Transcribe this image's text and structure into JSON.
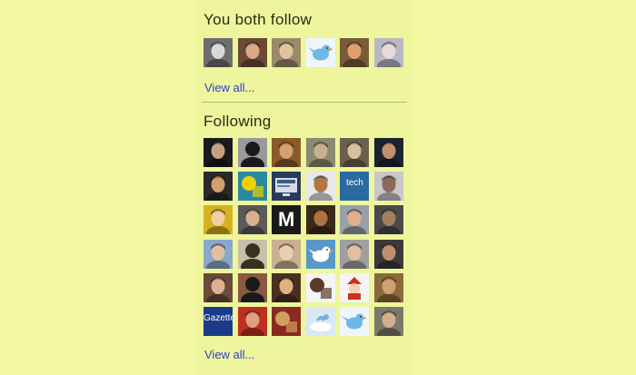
{
  "you_both_follow": {
    "title": "You both follow",
    "view_all": "View all...",
    "avatars": [
      {
        "icon": "person-avatar-icon",
        "bg": "#6e6e6e",
        "fg": "#d8d8d8"
      },
      {
        "icon": "person-avatar-icon",
        "bg": "#6a4a34",
        "fg": "#d8a888"
      },
      {
        "icon": "person-avatar-icon",
        "bg": "#9a8a6a",
        "fg": "#e0c4a0"
      },
      {
        "icon": "twitter-bird-icon",
        "bg": "#eef6fb",
        "fg": "#6fb7e6"
      },
      {
        "icon": "person-avatar-icon",
        "bg": "#7a5a3a",
        "fg": "#e0a070"
      },
      {
        "icon": "person-avatar-icon",
        "bg": "#b8b8c4",
        "fg": "#e6dada"
      }
    ]
  },
  "following": {
    "title": "Following",
    "view_all": "View all...",
    "avatars": [
      {
        "icon": "person-avatar-icon",
        "bg": "#1a1a1a",
        "fg": "#c8a080"
      },
      {
        "icon": "silhouette-avatar-icon",
        "bg": "#9a9a9a",
        "fg": "#1a1a1a"
      },
      {
        "icon": "person-avatar-icon",
        "bg": "#8a5a2a",
        "fg": "#d8a070"
      },
      {
        "icon": "person-avatar-icon",
        "bg": "#8a8a70",
        "fg": "#c8b090"
      },
      {
        "icon": "person-avatar-icon",
        "bg": "#6a6050",
        "fg": "#d8c0a0"
      },
      {
        "icon": "person-avatar-icon",
        "bg": "#1a2430",
        "fg": "#c09070"
      },
      {
        "icon": "person-avatar-icon",
        "bg": "#2a2a2a",
        "fg": "#d0a070"
      },
      {
        "icon": "abstract-avatar-icon",
        "bg": "#2a8aa0",
        "fg": "#f0d000"
      },
      {
        "icon": "screen-avatar-icon",
        "bg": "#2a3a5a",
        "fg": "#d8dce8"
      },
      {
        "icon": "person-avatar-icon",
        "bg": "#e8e8e8",
        "fg": "#b07848"
      },
      {
        "icon": "text-logo-avatar-icon",
        "bg": "#2a6aa0",
        "fg": "#ffffff",
        "text": "tech"
      },
      {
        "icon": "person-avatar-icon",
        "bg": "#c8c8c8",
        "fg": "#8a6a5a"
      },
      {
        "icon": "person-avatar-icon",
        "bg": "#d8b020",
        "fg": "#f0d0a0"
      },
      {
        "icon": "person-avatar-icon",
        "bg": "#5a5a5a",
        "fg": "#d8b090"
      },
      {
        "icon": "letter-logo-avatar-icon",
        "bg": "#1a1a1a",
        "fg": "#ffffff",
        "text": "M"
      },
      {
        "icon": "person-avatar-icon",
        "bg": "#3a2a1a",
        "fg": "#b07040"
      },
      {
        "icon": "person-avatar-icon",
        "bg": "#9aa0a8",
        "fg": "#e0b090"
      },
      {
        "icon": "person-avatar-icon",
        "bg": "#4a4a4a",
        "fg": "#a08060"
      },
      {
        "icon": "person-avatar-icon",
        "bg": "#8aa8c8",
        "fg": "#e0c0a0"
      },
      {
        "icon": "silhouette-avatar-icon",
        "bg": "#c8c0a8",
        "fg": "#3a3020"
      },
      {
        "icon": "person-avatar-icon",
        "bg": "#c8b090",
        "fg": "#e8d0b0"
      },
      {
        "icon": "twitter-bird-icon",
        "bg": "#5a98c8",
        "fg": "#ffffff"
      },
      {
        "icon": "person-avatar-icon",
        "bg": "#a0a0a0",
        "fg": "#e0c0a0"
      },
      {
        "icon": "person-avatar-icon",
        "bg": "#3a3a3a",
        "fg": "#c09070"
      },
      {
        "icon": "person-avatar-icon",
        "bg": "#6a4a3a",
        "fg": "#e0b090"
      },
      {
        "icon": "silhouette-avatar-icon",
        "bg": "#8a5a40",
        "fg": "#1a1a1a"
      },
      {
        "icon": "person-avatar-icon",
        "bg": "#4a3020",
        "fg": "#e0b080"
      },
      {
        "icon": "abstract-avatar-icon",
        "bg": "#f4f4f4",
        "fg": "#5a3a2a"
      },
      {
        "icon": "mascot-avatar-icon",
        "bg": "#f4f4f4",
        "fg": "#d03020"
      },
      {
        "icon": "person-avatar-icon",
        "bg": "#8a6a3a",
        "fg": "#d0a070"
      },
      {
        "icon": "text-logo-avatar-icon",
        "bg": "#1a3a8a",
        "fg": "#ffffff",
        "text": "Gazette"
      },
      {
        "icon": "person-avatar-icon",
        "bg": "#c03020",
        "fg": "#e0a080"
      },
      {
        "icon": "abstract-avatar-icon",
        "bg": "#8a2a20",
        "fg": "#d0a060"
      },
      {
        "icon": "cloud-avatar-icon",
        "bg": "#dae8f4",
        "fg": "#7ab0d8"
      },
      {
        "icon": "twitter-bird-icon",
        "bg": "#eef6fb",
        "fg": "#6fb7e6"
      },
      {
        "icon": "person-avatar-icon",
        "bg": "#7a7a6a",
        "fg": "#d0b090"
      }
    ]
  }
}
